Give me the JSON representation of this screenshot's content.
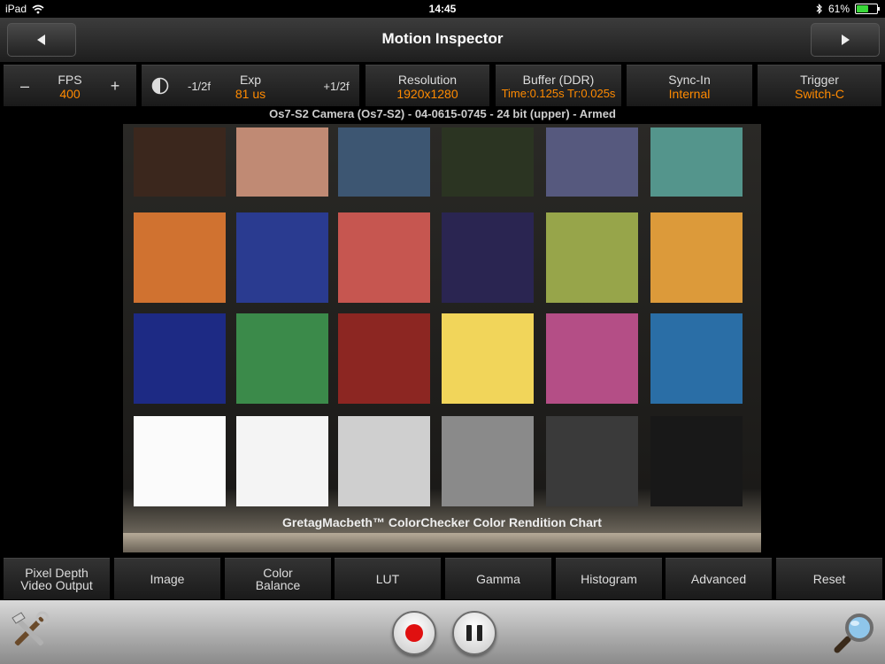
{
  "status_bar": {
    "device": "iPad",
    "time": "14:45",
    "battery": "61%",
    "battery_level": 0.61
  },
  "nav": {
    "title": "Motion Inspector",
    "icons": [
      "chevron-left-icon",
      "chevron-right-icon"
    ]
  },
  "toolbar": {
    "fps": {
      "label": "FPS",
      "value": "400",
      "minus": "–",
      "plus": "+"
    },
    "exposure": {
      "label": "Exp",
      "value": "81 us",
      "minus": "-1/2f",
      "plus": "+1/2f",
      "icon": "contrast-icon"
    },
    "resolution": {
      "label": "Resolution",
      "value": "1920x1280"
    },
    "buffer": {
      "label": "Buffer (DDR)",
      "value": "Time:0.125s Tr:0.025s"
    },
    "sync": {
      "label": "Sync-In",
      "value": "Internal"
    },
    "trigger": {
      "label": "Trigger",
      "value": "Switch-C"
    },
    "value_color": "#ff8a00"
  },
  "camera_label": "Os7-S2 Camera (Os7-S2) - 04-0615-0745 - 24 bit (upper) - Armed",
  "image": {
    "caption": "GretagMacbeth™ ColorChecker Color Rendition Chart",
    "patch_colors": [
      [
        "#3b271d",
        "#c08a74",
        "#3d5672",
        "#2b3422",
        "#56597e",
        "#54958c"
      ],
      [
        "#d07230",
        "#2a3b90",
        "#c65650",
        "#2a2551",
        "#97a54a",
        "#dc9a3a"
      ],
      [
        "#1d2a84",
        "#3b8a4a",
        "#8c2622",
        "#f1d55a",
        "#b44e86",
        "#2a6ea6"
      ],
      [
        "#fbfbfb",
        "#f4f4f4",
        "#cfcfcf",
        "#8a8a8a",
        "#3a3a3a",
        "#181818"
      ]
    ]
  },
  "bottom_tabs": [
    {
      "line1": "Pixel Depth",
      "line2": "Video Output"
    },
    {
      "line1": "Image",
      "line2": ""
    },
    {
      "line1": "Color",
      "line2": "Balance"
    },
    {
      "line1": "LUT",
      "line2": ""
    },
    {
      "line1": "Gamma",
      "line2": ""
    },
    {
      "line1": "Histogram",
      "line2": ""
    },
    {
      "line1": "Advanced",
      "line2": ""
    },
    {
      "line1": "Reset",
      "line2": ""
    }
  ],
  "bottom_bar": {
    "icons": [
      "tools-icon",
      "record-icon",
      "pause-icon",
      "magnifier-icon"
    ],
    "record_color": "#e01010"
  }
}
